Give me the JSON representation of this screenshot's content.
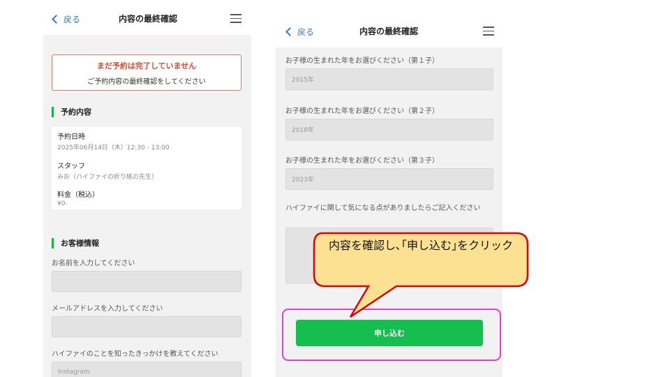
{
  "left_screen": {
    "header": {
      "back_label": "戻る",
      "title": "内容の最終確認"
    },
    "alert": {
      "line1": "まだ予約は完了していません",
      "line2": "ご予約内容の最終確認をしてください"
    },
    "reservation": {
      "section_title": "予約内容",
      "datetime_label": "予約日時",
      "datetime_value": "2025年06月14日（木）12:30 - 13:00",
      "staff_label": "スタッフ",
      "staff_value": "みお（ハイファイの折り紙の先生）",
      "fee_label": "料金（税込）",
      "fee_value": "¥0-"
    },
    "customer": {
      "section_title": "お客様情報",
      "name_label": "お名前を入力してください",
      "name_value": "",
      "email_label": "メールアドレスを入力してください",
      "email_value": "",
      "source_label": "ハイファイのことを知ったきっかけを教えてください",
      "source_value": "Instagram"
    }
  },
  "right_screen": {
    "header": {
      "back_label": "戻る",
      "title": "内容の最終確認"
    },
    "fields": [
      {
        "label": "お子様の生まれた年をお選びください（第１子）",
        "value": "2015年"
      },
      {
        "label": "お子様の生まれた年をお選びください（第２子）",
        "value": "2018年"
      },
      {
        "label": "お子様の生まれた年をお選びください（第３子）",
        "value": "2023年"
      }
    ],
    "concerns_label": "ハイファイに関して気になる点がありましたらご記入ください",
    "concerns_value": "",
    "apply_button": "申し込む"
  },
  "callout": {
    "text": "内容を確認し､｢申し込む｣をクリック",
    "fill_color": "#fbe191",
    "border_color": "#e0000b"
  },
  "highlight_color": "#e23fd0",
  "accent_color": "#16bd4f"
}
